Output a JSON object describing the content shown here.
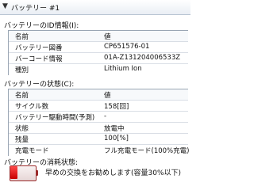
{
  "header": {
    "title": "バッテリー #1"
  },
  "id_section": {
    "title": "バッテリーのID情報(I):",
    "header": {
      "name": "名前",
      "value": "値"
    },
    "rows": [
      {
        "name": "バッテリー図番",
        "value": "CP651576-01"
      },
      {
        "name": "バーコード情報",
        "value": "01A-Z131204006533Z"
      },
      {
        "name": "種別",
        "value": "Lithium Ion"
      }
    ]
  },
  "status_section": {
    "title": "バッテリーの状態(C):",
    "header": {
      "name": "名前",
      "value": "値"
    },
    "rows": [
      {
        "name": "サイクル数",
        "value": "158[回]"
      },
      {
        "name": "バッテリー駆動時間(予測)",
        "value": "-"
      },
      {
        "name": "状態",
        "value": "放電中"
      },
      {
        "name": "残量",
        "value": "100[%]"
      },
      {
        "name": "充電モード",
        "value": "フル充電モード(100%充電)"
      }
    ]
  },
  "wear_section": {
    "title": "バッテリーの消耗状態:",
    "message": "早めの交換をお勧めします(容量30%以下)",
    "battery_level": 0.3,
    "battery_color": "#d00000"
  }
}
